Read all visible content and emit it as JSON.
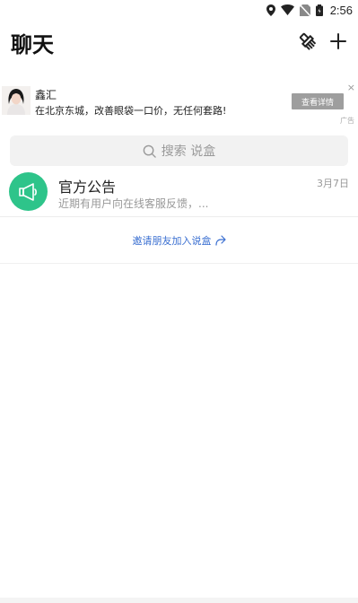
{
  "status_bar": {
    "time": "2:56",
    "icons": [
      "location-icon",
      "wifi-icon",
      "no-sim-icon",
      "battery-icon"
    ]
  },
  "header": {
    "title": "聊天",
    "actions": [
      "brush-icon",
      "add-icon"
    ]
  },
  "ad": {
    "name": "鑫汇",
    "text": "在北京东城，改善眼袋一口价，无任何套路!",
    "button_label": "查看详情",
    "close_symbol": "×",
    "badge": "广告"
  },
  "search": {
    "placeholder": "搜索 说盒"
  },
  "conversations": [
    {
      "name": "官方公告",
      "preview": "近期有用户向在线客服反馈，...",
      "date": "3月7日",
      "avatar_icon": "megaphone-icon",
      "avatar_color": "#2ec48a"
    }
  ],
  "invite": {
    "label": "邀请朋友加入说盒"
  },
  "colors": {
    "accent_link": "#3a6fd1",
    "avatar_green": "#2ec48a"
  }
}
